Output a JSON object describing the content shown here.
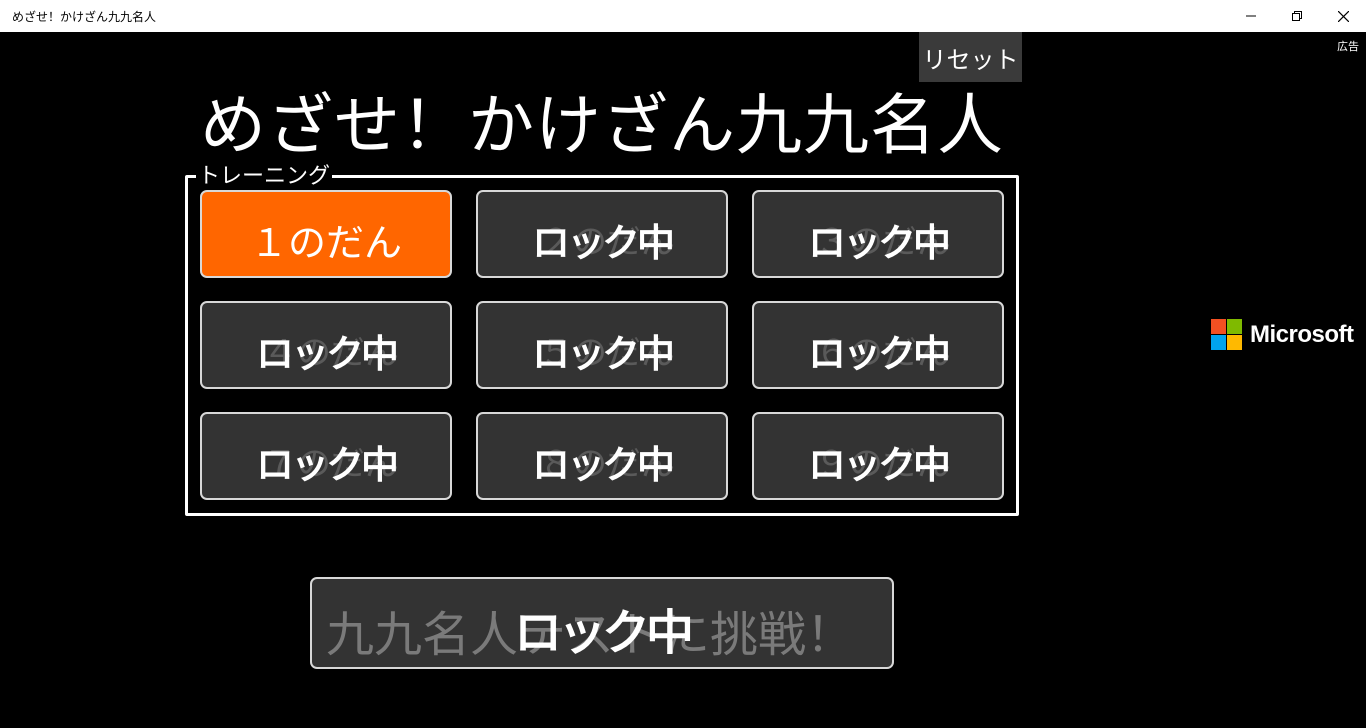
{
  "window": {
    "title": "めざせ！かけざん九九名人"
  },
  "ad": {
    "label": "広告",
    "brand": "Microsoft",
    "colors": [
      "#f25022",
      "#7fba00",
      "#00a4ef",
      "#ffb900"
    ]
  },
  "header": {
    "reset_label": "リセット",
    "title": "めざせ！かけざん九九名人"
  },
  "training": {
    "label": "トレーニング",
    "stages": [
      {
        "label": "１のだん",
        "locked": false,
        "lock_label": ""
      },
      {
        "label": "２のだん",
        "locked": true,
        "lock_label": "ロック中"
      },
      {
        "label": "３のだん",
        "locked": true,
        "lock_label": "ロック中"
      },
      {
        "label": "４のだん",
        "locked": true,
        "lock_label": "ロック中"
      },
      {
        "label": "５のだん",
        "locked": true,
        "lock_label": "ロック中"
      },
      {
        "label": "６のだん",
        "locked": true,
        "lock_label": "ロック中"
      },
      {
        "label": "７のだん",
        "locked": true,
        "lock_label": "ロック中"
      },
      {
        "label": "８のだん",
        "locked": true,
        "lock_label": "ロック中"
      },
      {
        "label": "９のだん",
        "locked": true,
        "lock_label": "ロック中"
      }
    ]
  },
  "challenge": {
    "label": "九九名人テストに挑戦！",
    "lock_label": "ロック中"
  },
  "colors": {
    "accent": "#ff6600",
    "button_bg": "#333333"
  }
}
